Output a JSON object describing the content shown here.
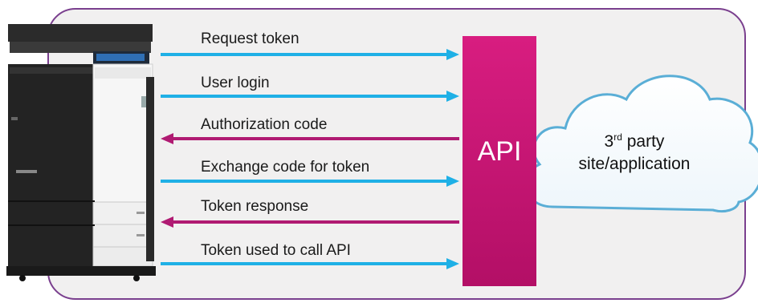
{
  "flows": [
    {
      "label": "Request token",
      "direction": "to-api"
    },
    {
      "label": "User login",
      "direction": "to-api"
    },
    {
      "label": "Authorization code",
      "direction": "to-device"
    },
    {
      "label": "Exchange code for token",
      "direction": "to-api"
    },
    {
      "label": "Token response",
      "direction": "to-device"
    },
    {
      "label": "Token used to call API",
      "direction": "to-api"
    }
  ],
  "api": {
    "label": "API",
    "color": "#c0136e"
  },
  "cloud": {
    "line1_num": "3",
    "line1_sup": "rd",
    "line1_rest": " party",
    "line2": "site/application"
  },
  "colors": {
    "to_api": "#1fb0e6",
    "to_device": "#b01a72",
    "frame_border": "#7a3f8e",
    "frame_fill": "#f1f0f0"
  }
}
